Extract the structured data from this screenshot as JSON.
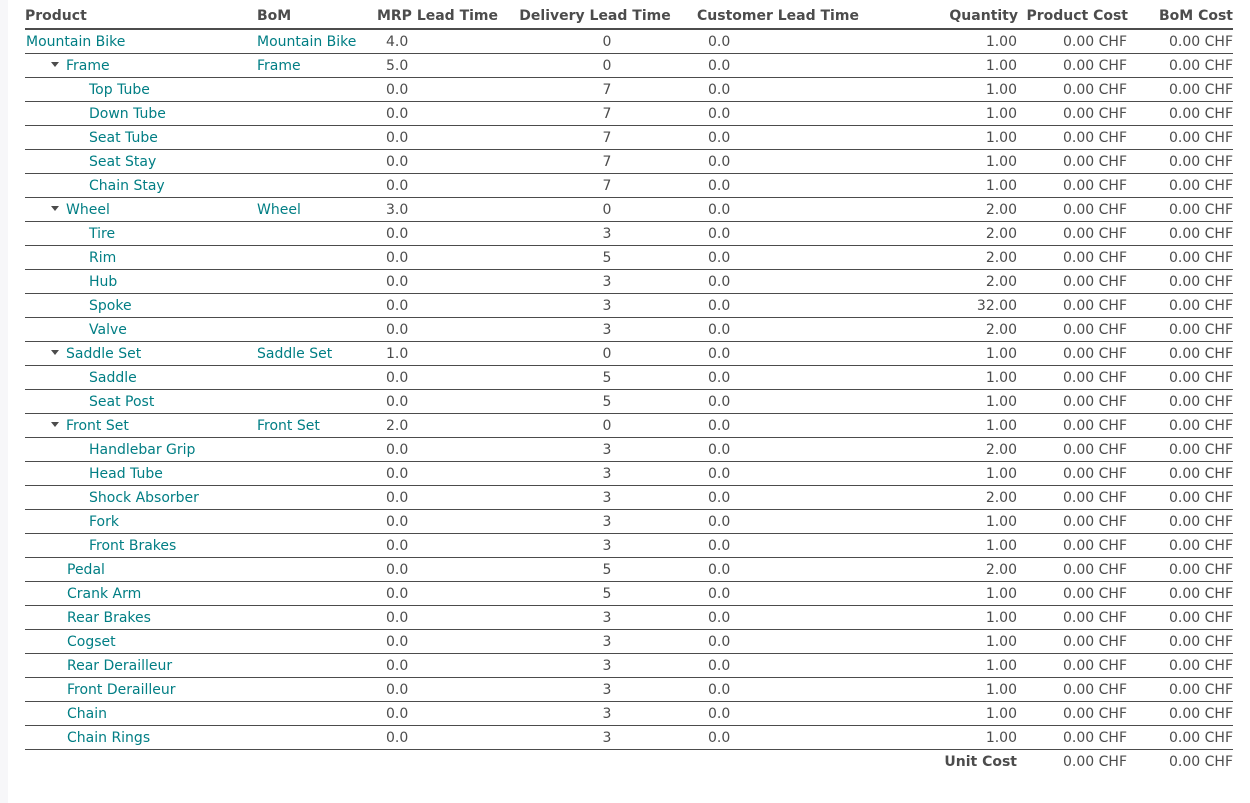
{
  "columns": [
    "Product",
    "BoM",
    "MRP Lead Time",
    "Delivery Lead Time",
    "Customer Lead Time",
    "Quantity",
    "Product Cost",
    "BoM Cost"
  ],
  "rows": [
    {
      "product": "Mountain Bike",
      "bom": "Mountain Bike",
      "mrp": "4.0",
      "delivery": "0",
      "customer": "0.0",
      "qty": "1.00",
      "product_cost": "0.00 CHF",
      "bom_cost": "0.00 CHF",
      "level": 0,
      "expandable": false
    },
    {
      "product": "Frame",
      "bom": "Frame",
      "mrp": "5.0",
      "delivery": "0",
      "customer": "0.0",
      "qty": "1.00",
      "product_cost": "0.00 CHF",
      "bom_cost": "0.00 CHF",
      "level": 1,
      "expandable": true
    },
    {
      "product": "Top Tube",
      "bom": "",
      "mrp": "0.0",
      "delivery": "7",
      "customer": "0.0",
      "qty": "1.00",
      "product_cost": "0.00 CHF",
      "bom_cost": "0.00 CHF",
      "level": 2,
      "expandable": false
    },
    {
      "product": "Down Tube",
      "bom": "",
      "mrp": "0.0",
      "delivery": "7",
      "customer": "0.0",
      "qty": "1.00",
      "product_cost": "0.00 CHF",
      "bom_cost": "0.00 CHF",
      "level": 2,
      "expandable": false
    },
    {
      "product": "Seat Tube",
      "bom": "",
      "mrp": "0.0",
      "delivery": "7",
      "customer": "0.0",
      "qty": "1.00",
      "product_cost": "0.00 CHF",
      "bom_cost": "0.00 CHF",
      "level": 2,
      "expandable": false
    },
    {
      "product": "Seat Stay",
      "bom": "",
      "mrp": "0.0",
      "delivery": "7",
      "customer": "0.0",
      "qty": "1.00",
      "product_cost": "0.00 CHF",
      "bom_cost": "0.00 CHF",
      "level": 2,
      "expandable": false
    },
    {
      "product": "Chain Stay",
      "bom": "",
      "mrp": "0.0",
      "delivery": "7",
      "customer": "0.0",
      "qty": "1.00",
      "product_cost": "0.00 CHF",
      "bom_cost": "0.00 CHF",
      "level": 2,
      "expandable": false
    },
    {
      "product": "Wheel",
      "bom": "Wheel",
      "mrp": "3.0",
      "delivery": "0",
      "customer": "0.0",
      "qty": "2.00",
      "product_cost": "0.00 CHF",
      "bom_cost": "0.00 CHF",
      "level": 1,
      "expandable": true
    },
    {
      "product": "Tire",
      "bom": "",
      "mrp": "0.0",
      "delivery": "3",
      "customer": "0.0",
      "qty": "2.00",
      "product_cost": "0.00 CHF",
      "bom_cost": "0.00 CHF",
      "level": 2,
      "expandable": false
    },
    {
      "product": "Rim",
      "bom": "",
      "mrp": "0.0",
      "delivery": "5",
      "customer": "0.0",
      "qty": "2.00",
      "product_cost": "0.00 CHF",
      "bom_cost": "0.00 CHF",
      "level": 2,
      "expandable": false
    },
    {
      "product": "Hub",
      "bom": "",
      "mrp": "0.0",
      "delivery": "3",
      "customer": "0.0",
      "qty": "2.00",
      "product_cost": "0.00 CHF",
      "bom_cost": "0.00 CHF",
      "level": 2,
      "expandable": false
    },
    {
      "product": "Spoke",
      "bom": "",
      "mrp": "0.0",
      "delivery": "3",
      "customer": "0.0",
      "qty": "32.00",
      "product_cost": "0.00 CHF",
      "bom_cost": "0.00 CHF",
      "level": 2,
      "expandable": false
    },
    {
      "product": "Valve",
      "bom": "",
      "mrp": "0.0",
      "delivery": "3",
      "customer": "0.0",
      "qty": "2.00",
      "product_cost": "0.00 CHF",
      "bom_cost": "0.00 CHF",
      "level": 2,
      "expandable": false
    },
    {
      "product": "Saddle Set",
      "bom": "Saddle Set",
      "mrp": "1.0",
      "delivery": "0",
      "customer": "0.0",
      "qty": "1.00",
      "product_cost": "0.00 CHF",
      "bom_cost": "0.00 CHF",
      "level": 1,
      "expandable": true
    },
    {
      "product": "Saddle",
      "bom": "",
      "mrp": "0.0",
      "delivery": "5",
      "customer": "0.0",
      "qty": "1.00",
      "product_cost": "0.00 CHF",
      "bom_cost": "0.00 CHF",
      "level": 2,
      "expandable": false
    },
    {
      "product": "Seat Post",
      "bom": "",
      "mrp": "0.0",
      "delivery": "5",
      "customer": "0.0",
      "qty": "1.00",
      "product_cost": "0.00 CHF",
      "bom_cost": "0.00 CHF",
      "level": 2,
      "expandable": false
    },
    {
      "product": "Front Set",
      "bom": "Front Set",
      "mrp": "2.0",
      "delivery": "0",
      "customer": "0.0",
      "qty": "1.00",
      "product_cost": "0.00 CHF",
      "bom_cost": "0.00 CHF",
      "level": 1,
      "expandable": true
    },
    {
      "product": "Handlebar Grip",
      "bom": "",
      "mrp": "0.0",
      "delivery": "3",
      "customer": "0.0",
      "qty": "2.00",
      "product_cost": "0.00 CHF",
      "bom_cost": "0.00 CHF",
      "level": 2,
      "expandable": false
    },
    {
      "product": "Head Tube",
      "bom": "",
      "mrp": "0.0",
      "delivery": "3",
      "customer": "0.0",
      "qty": "1.00",
      "product_cost": "0.00 CHF",
      "bom_cost": "0.00 CHF",
      "level": 2,
      "expandable": false
    },
    {
      "product": "Shock Absorber",
      "bom": "",
      "mrp": "0.0",
      "delivery": "3",
      "customer": "0.0",
      "qty": "2.00",
      "product_cost": "0.00 CHF",
      "bom_cost": "0.00 CHF",
      "level": 2,
      "expandable": false
    },
    {
      "product": "Fork",
      "bom": "",
      "mrp": "0.0",
      "delivery": "3",
      "customer": "0.0",
      "qty": "1.00",
      "product_cost": "0.00 CHF",
      "bom_cost": "0.00 CHF",
      "level": 2,
      "expandable": false
    },
    {
      "product": "Front Brakes",
      "bom": "",
      "mrp": "0.0",
      "delivery": "3",
      "customer": "0.0",
      "qty": "1.00",
      "product_cost": "0.00 CHF",
      "bom_cost": "0.00 CHF",
      "level": 2,
      "expandable": false
    },
    {
      "product": "Pedal",
      "bom": "",
      "mrp": "0.0",
      "delivery": "5",
      "customer": "0.0",
      "qty": "2.00",
      "product_cost": "0.00 CHF",
      "bom_cost": "0.00 CHF",
      "level": 1,
      "expandable": false
    },
    {
      "product": "Crank Arm",
      "bom": "",
      "mrp": "0.0",
      "delivery": "5",
      "customer": "0.0",
      "qty": "1.00",
      "product_cost": "0.00 CHF",
      "bom_cost": "0.00 CHF",
      "level": 1,
      "expandable": false
    },
    {
      "product": "Rear Brakes",
      "bom": "",
      "mrp": "0.0",
      "delivery": "3",
      "customer": "0.0",
      "qty": "1.00",
      "product_cost": "0.00 CHF",
      "bom_cost": "0.00 CHF",
      "level": 1,
      "expandable": false
    },
    {
      "product": "Cogset",
      "bom": "",
      "mrp": "0.0",
      "delivery": "3",
      "customer": "0.0",
      "qty": "1.00",
      "product_cost": "0.00 CHF",
      "bom_cost": "0.00 CHF",
      "level": 1,
      "expandable": false
    },
    {
      "product": "Rear Derailleur",
      "bom": "",
      "mrp": "0.0",
      "delivery": "3",
      "customer": "0.0",
      "qty": "1.00",
      "product_cost": "0.00 CHF",
      "bom_cost": "0.00 CHF",
      "level": 1,
      "expandable": false
    },
    {
      "product": "Front Derailleur",
      "bom": "",
      "mrp": "0.0",
      "delivery": "3",
      "customer": "0.0",
      "qty": "1.00",
      "product_cost": "0.00 CHF",
      "bom_cost": "0.00 CHF",
      "level": 1,
      "expandable": false
    },
    {
      "product": "Chain",
      "bom": "",
      "mrp": "0.0",
      "delivery": "3",
      "customer": "0.0",
      "qty": "1.00",
      "product_cost": "0.00 CHF",
      "bom_cost": "0.00 CHF",
      "level": 1,
      "expandable": false
    },
    {
      "product": "Chain Rings",
      "bom": "",
      "mrp": "0.0",
      "delivery": "3",
      "customer": "0.0",
      "qty": "1.00",
      "product_cost": "0.00 CHF",
      "bom_cost": "0.00 CHF",
      "level": 1,
      "expandable": false
    }
  ],
  "footer": {
    "label": "Unit Cost",
    "product_cost": "0.00 CHF",
    "bom_cost": "0.00 CHF"
  },
  "colors": {
    "link": "#017e84",
    "text": "#4c4c4c",
    "border": "#4c4c4c",
    "background": "#ffffff"
  }
}
